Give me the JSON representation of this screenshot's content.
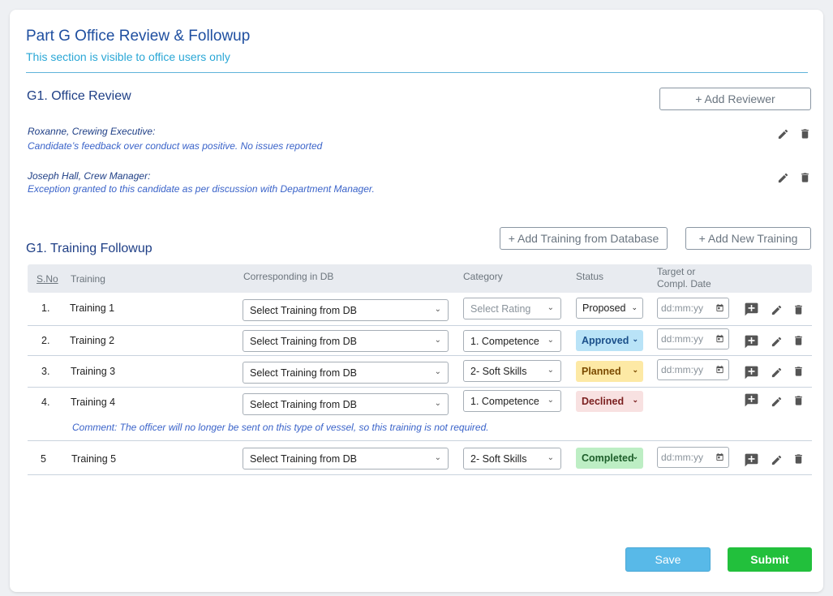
{
  "header": {
    "title": "Part G Office Review & Followup",
    "subtitle": "This section is visible to office users only"
  },
  "office_review": {
    "title": "G1. Office Review",
    "add_reviewer_label": "+ Add Reviewer",
    "reviews": [
      {
        "name": "Roxanne, Crewing Executive:",
        "text": "Candidate’s feedback over conduct was positive. No issues reported"
      },
      {
        "name": "Joseph Hall, Crew Manager:",
        "text": "Exception granted to this candidate as per discussion with Department Manager."
      }
    ]
  },
  "training": {
    "title": "G1. Training Followup",
    "add_from_db_label": "+ Add Training from Database",
    "add_new_label": "+ Add New Training",
    "columns": {
      "sno": "S.No",
      "training": "Training",
      "corresponding": "Corresponding in DB",
      "category": "Category",
      "status": "Status",
      "target_line1": "Target or",
      "target_line2": "Compl. Date"
    },
    "rows": [
      {
        "sno": "1.",
        "name": "Training 1",
        "db": "Select Training from DB",
        "category": "Select Rating",
        "status": "Proposed",
        "date": "dd:mm:yy"
      },
      {
        "sno": "2.",
        "name": "Training 2",
        "db": "Select Training from DB",
        "category": "1. Competence",
        "status": "Approved",
        "date": "dd:mm:yy"
      },
      {
        "sno": "3.",
        "name": "Training 3",
        "db": "Select Training from DB",
        "category": "2- Soft Skills",
        "status": "Planned",
        "date": "dd:mm:yy"
      },
      {
        "sno": "4.",
        "name": "Training 4",
        "db": "Select Training from DB",
        "category": "1. Competence",
        "status": "Declined",
        "comment": "Comment: The officer will no longer be sent on this type of vessel, so this training is not required."
      },
      {
        "sno": "5",
        "name": "Training 5",
        "db": "Select Training from DB",
        "category": "2- Soft Skills",
        "status": "Completed",
        "date": "dd:mm:yy"
      }
    ]
  },
  "footer": {
    "save_label": "Save",
    "submit_label": "Submit"
  },
  "colors": {
    "title": "#1f4fa0",
    "subtitle": "#2aa7d6",
    "status_proposed_bg": "#ffffff",
    "status_approved_bg": "#b9e3f7",
    "status_planned_bg": "#fde9a5",
    "status_declined_bg": "#f8e1e1",
    "status_completed_bg": "#bdeec4",
    "save": "#58b9e8",
    "submit": "#22c03c"
  },
  "icons": [
    "edit-icon",
    "trash-icon",
    "add-comment-icon",
    "chevron-down-icon",
    "calendar-icon"
  ]
}
